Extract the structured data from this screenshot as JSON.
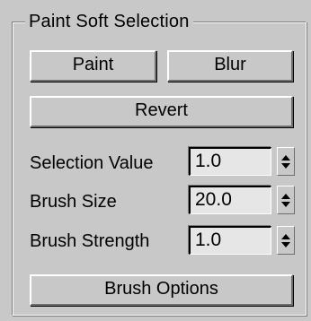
{
  "group": {
    "title": "Paint Soft Selection"
  },
  "buttons": {
    "paint": "Paint",
    "blur": "Blur",
    "revert": "Revert",
    "brush_options": "Brush Options"
  },
  "fields": [
    {
      "label": "Selection Value",
      "value": "1.0"
    },
    {
      "label": "Brush Size",
      "value": "20.0"
    },
    {
      "label": "Brush Strength",
      "value": "1.0"
    }
  ],
  "icons": {
    "spinner_up": "arrow-up-icon",
    "spinner_down": "arrow-down-icon"
  }
}
